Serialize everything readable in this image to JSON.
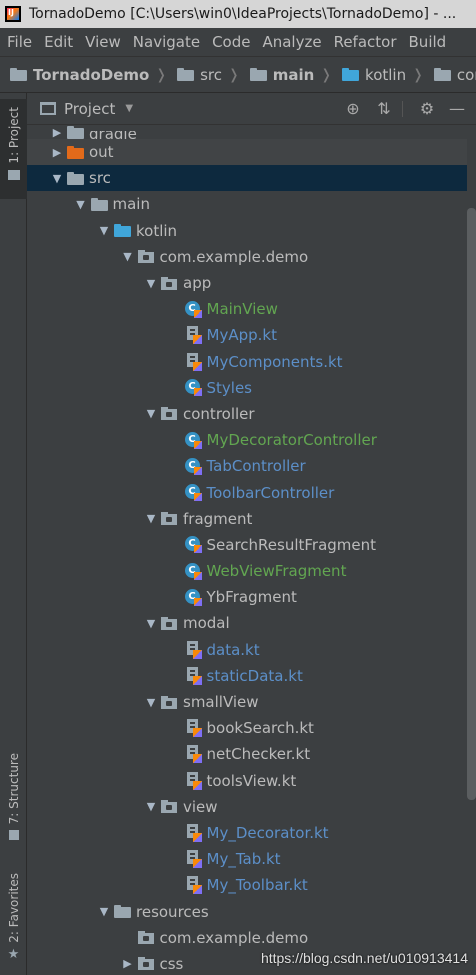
{
  "window": {
    "title": "TornadoDemo [C:\\Users\\win0\\IdeaProjects\\TornadoDemo] - ..."
  },
  "menu": [
    "File",
    "Edit",
    "View",
    "Navigate",
    "Code",
    "Analyze",
    "Refactor",
    "Build"
  ],
  "breadcrumbs": [
    {
      "label": "TornadoDemo",
      "icon": "folder-icon"
    },
    {
      "label": "src",
      "icon": "folder-icon"
    },
    {
      "label": "main",
      "icon": "folder-icon"
    },
    {
      "label": "kotlin",
      "icon": "source-folder-icon"
    },
    {
      "label": "com",
      "icon": "folder-icon"
    }
  ],
  "tool_stripe": {
    "project_tab": "1: Project",
    "structure_tab": "7: Structure",
    "favorites_tab": "2: Favorites"
  },
  "panel": {
    "title": "Project",
    "buttons": [
      "locate-icon",
      "collapse-all-icon",
      "settings-icon",
      "hide-icon"
    ]
  },
  "tree": [
    {
      "label": "gradle",
      "depth": 1,
      "expand": "collapsed",
      "icon": "folder",
      "cut": true
    },
    {
      "label": "out",
      "depth": 1,
      "expand": "collapsed",
      "icon": "folder-orange"
    },
    {
      "label": "src",
      "depth": 1,
      "expand": "expanded",
      "icon": "folder",
      "selected": true
    },
    {
      "label": "main",
      "depth": 2,
      "expand": "expanded",
      "icon": "folder"
    },
    {
      "label": "kotlin",
      "depth": 3,
      "expand": "expanded",
      "icon": "folder-blue"
    },
    {
      "label": "com.example.demo",
      "depth": 4,
      "expand": "expanded",
      "icon": "package"
    },
    {
      "label": "app",
      "depth": 5,
      "expand": "expanded",
      "icon": "package"
    },
    {
      "label": "MainView",
      "depth": 6,
      "icon": "kotlin-class",
      "color": "green"
    },
    {
      "label": "MyApp.kt",
      "depth": 6,
      "icon": "kotlin-file",
      "color": "blue"
    },
    {
      "label": "MyComponents.kt",
      "depth": 6,
      "icon": "kotlin-file",
      "color": "blue"
    },
    {
      "label": "Styles",
      "depth": 6,
      "icon": "kotlin-class",
      "color": "blue"
    },
    {
      "label": "controller",
      "depth": 5,
      "expand": "expanded",
      "icon": "package"
    },
    {
      "label": "MyDecoratorController",
      "depth": 6,
      "icon": "kotlin-class",
      "color": "green"
    },
    {
      "label": "TabController",
      "depth": 6,
      "icon": "kotlin-class",
      "color": "blue"
    },
    {
      "label": "ToolbarController",
      "depth": 6,
      "icon": "kotlin-class",
      "color": "blue"
    },
    {
      "label": "fragment",
      "depth": 5,
      "expand": "expanded",
      "icon": "package"
    },
    {
      "label": "SearchResultFragment",
      "depth": 6,
      "icon": "kotlin-class",
      "color": "default"
    },
    {
      "label": "WebViewFragment",
      "depth": 6,
      "icon": "kotlin-class",
      "color": "green"
    },
    {
      "label": "YbFragment",
      "depth": 6,
      "icon": "kotlin-class",
      "color": "default"
    },
    {
      "label": "modal",
      "depth": 5,
      "expand": "expanded",
      "icon": "package"
    },
    {
      "label": "data.kt",
      "depth": 6,
      "icon": "kotlin-file",
      "color": "blue"
    },
    {
      "label": "staticData.kt",
      "depth": 6,
      "icon": "kotlin-file",
      "color": "blue"
    },
    {
      "label": "smallView",
      "depth": 5,
      "expand": "expanded",
      "icon": "package"
    },
    {
      "label": "bookSearch.kt",
      "depth": 6,
      "icon": "kotlin-file",
      "color": "default"
    },
    {
      "label": "netChecker.kt",
      "depth": 6,
      "icon": "kotlin-file",
      "color": "default"
    },
    {
      "label": "toolsView.kt",
      "depth": 6,
      "icon": "kotlin-file",
      "color": "default"
    },
    {
      "label": "view",
      "depth": 5,
      "expand": "expanded",
      "icon": "package"
    },
    {
      "label": "My_Decorator.kt",
      "depth": 6,
      "icon": "kotlin-file",
      "color": "blue"
    },
    {
      "label": "My_Tab.kt",
      "depth": 6,
      "icon": "kotlin-file",
      "color": "blue"
    },
    {
      "label": "My_Toolbar.kt",
      "depth": 6,
      "icon": "kotlin-file",
      "color": "blue"
    },
    {
      "label": "resources",
      "depth": 3,
      "expand": "expanded",
      "icon": "folder-resources"
    },
    {
      "label": "com.example.demo",
      "depth": 4,
      "expand": "none",
      "icon": "package"
    },
    {
      "label": "css",
      "depth": 4,
      "expand": "collapsed",
      "icon": "package"
    }
  ],
  "watermark": "https://blog.csdn.net/u010913414",
  "colors": {
    "selection": "#0d293e",
    "green_label": "#62a651",
    "blue_label": "#5c8fc8",
    "background": "#3c3f41"
  }
}
